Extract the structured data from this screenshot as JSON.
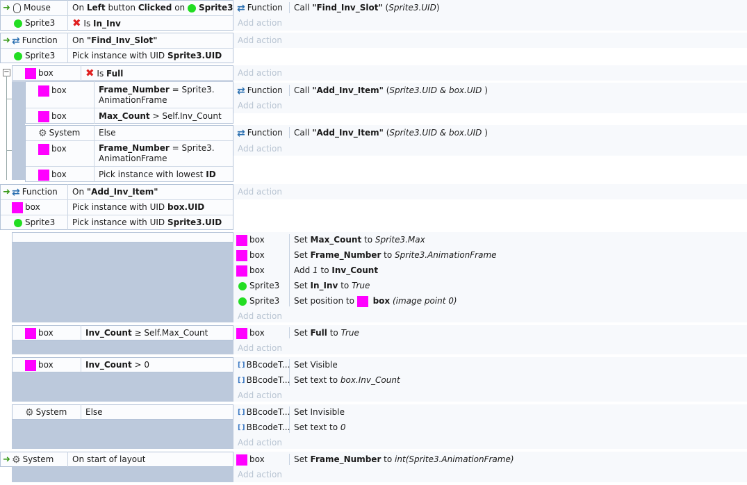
{
  "objects": {
    "mouse": "Mouse",
    "sprite": "Sprite3",
    "function": "Function",
    "box": "box",
    "system": "System",
    "bbcode": "BBcodeT..."
  },
  "add_action": "Add action",
  "ev1": {
    "cond1": {
      "a": "On ",
      "b": "Left",
      "c": " button ",
      "d": "Clicked",
      "e": " on ",
      "f": "Sprite3"
    },
    "cond2": {
      "a": "Is ",
      "b": "In_Inv"
    },
    "act1": {
      "a": "Call ",
      "b": "\"Find_Inv_Slot\"",
      "c": " (",
      "d": "Sprite3.UID",
      "e": ")"
    }
  },
  "ev2": {
    "cond1": {
      "a": "On ",
      "b": "\"Find_Inv_Slot\""
    },
    "cond2": {
      "a": "Pick instance with UID ",
      "b": "Sprite3.UID"
    }
  },
  "ev3": {
    "cond1": {
      "a": "Is ",
      "b": "Full"
    }
  },
  "ev3a": {
    "cond1": {
      "a": "Frame_Number",
      "b": " = Sprite3.",
      "c": "AnimationFrame"
    },
    "cond2": {
      "a": "Max_Count",
      "b": " > Self.Inv_Count"
    },
    "act1": {
      "a": "Call ",
      "b": "\"Add_Inv_Item\"",
      "c": " (",
      "d": "Sprite3.UID & box.UID",
      "e": " )"
    }
  },
  "ev3b": {
    "cond1": "Else",
    "cond2": {
      "a": "Frame_Number",
      "b": " = Sprite3.",
      "c": "AnimationFrame"
    },
    "cond3": {
      "a": "Pick instance with lowest ",
      "b": "ID"
    },
    "act1": {
      "a": "Call ",
      "b": "\"Add_Inv_Item\"",
      "c": " (",
      "d": "Sprite3.UID & box.UID",
      "e": " )"
    }
  },
  "ev4": {
    "cond1": {
      "a": "On ",
      "b": "\"Add_Inv_Item\""
    },
    "cond2": {
      "a": "Pick instance with UID ",
      "b": "box.UID"
    },
    "cond3": {
      "a": "Pick instance with UID ",
      "b": "Sprite3.UID"
    }
  },
  "ev5": {
    "act1": {
      "a": "Set ",
      "b": "Max_Count",
      "c": " to ",
      "d": "Sprite3.Max"
    },
    "act2": {
      "a": "Set ",
      "b": "Frame_Number",
      "c": " to ",
      "d": "Sprite3.AnimationFrame"
    },
    "act3": {
      "a": "Add ",
      "b": "1",
      "c": " to ",
      "d": "Inv_Count"
    },
    "act4": {
      "a": "Set ",
      "b": "In_Inv",
      "c": " to ",
      "d": "True"
    },
    "act5": {
      "a": "Set position to ",
      "b": "box",
      "c": " (image point 0)"
    }
  },
  "ev6": {
    "cond1": {
      "a": "Inv_Count",
      "b": " ≥ Self.Max_Count"
    },
    "act1": {
      "a": "Set ",
      "b": "Full",
      "c": " to ",
      "d": "True"
    }
  },
  "ev7": {
    "cond1": {
      "a": "Inv_Count",
      "b": " > 0"
    },
    "act1": "Set Visible",
    "act2": {
      "a": "Set text to ",
      "b": "box.Inv_Count"
    }
  },
  "ev8": {
    "cond1": "Else",
    "act1": "Set Invisible",
    "act2": {
      "a": "Set text to ",
      "b": "0"
    }
  },
  "ev9": {
    "cond1": "On start of layout",
    "act1": {
      "a": "Set ",
      "b": "Frame_Number",
      "c": " to ",
      "d": "int(Sprite3.AnimationFrame)"
    }
  }
}
